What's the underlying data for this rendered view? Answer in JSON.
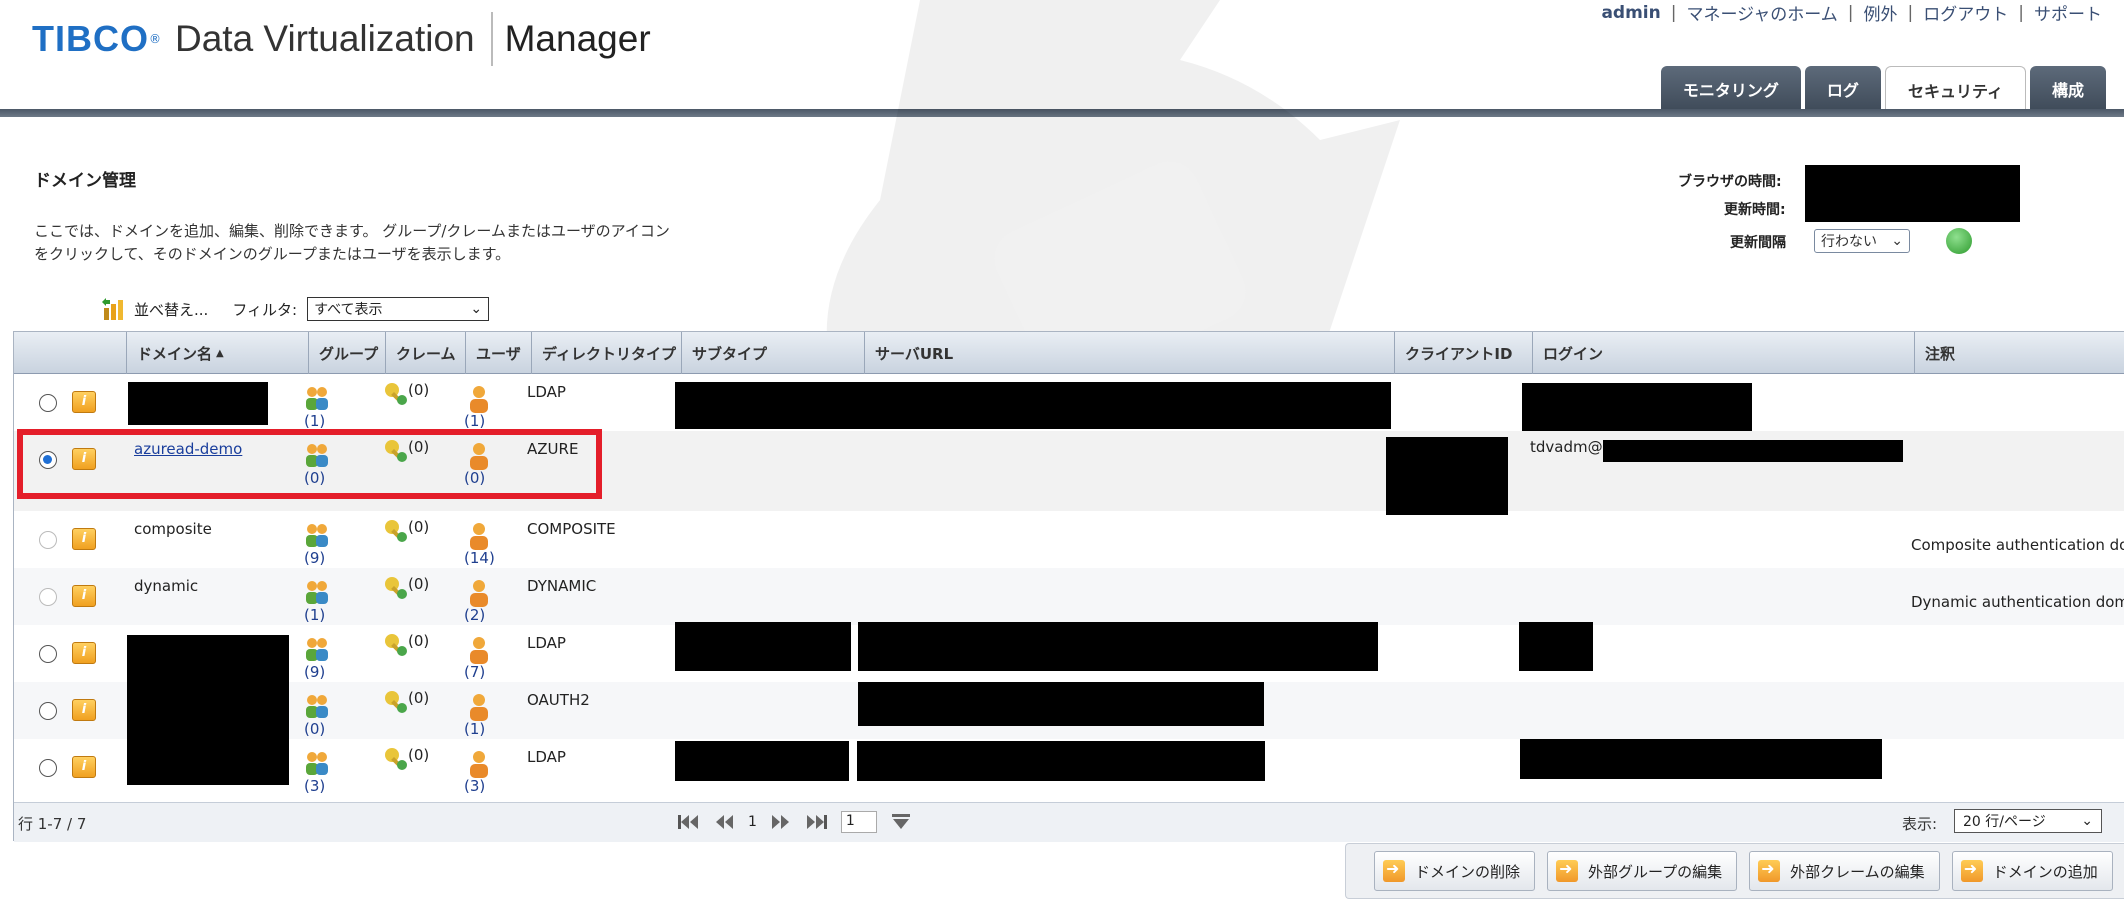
{
  "header": {
    "logo_brand": "TIBCO",
    "logo_reg": "®",
    "logo_product": "Data Virtualization",
    "logo_app": "Manager",
    "links": {
      "user": "admin",
      "home": "マネージャのホーム",
      "exceptions": "例外",
      "logout": "ログアウト",
      "support": "サポート"
    },
    "tabs": [
      {
        "label": "モニタリング",
        "active": false
      },
      {
        "label": "ログ",
        "active": false
      },
      {
        "label": "セキュリティ",
        "active": true
      },
      {
        "label": "構成",
        "active": false
      }
    ]
  },
  "page": {
    "title": "ドメイン管理",
    "description": "ここでは、ドメインを追加、編集、削除できます。 グループ/クレームまたはユーザのアイコンをクリックして、そのドメインのグループまたはユーザを表示します。"
  },
  "time_panel": {
    "browser_time_label": "ブラウザの時間:",
    "update_time_label": "更新時間:",
    "refresh_interval_label": "更新間隔",
    "refresh_interval_value": "行わない"
  },
  "toolbar": {
    "sort_label": "並べ替え...",
    "filter_label": "フィルタ:",
    "filter_value": "すべて表示"
  },
  "table": {
    "columns": {
      "domain_name": "ドメイン名",
      "group": "グループ",
      "claim": "クレーム",
      "user": "ユーザ",
      "directory_type": "ディレクトリタイプ",
      "subtype": "サブタイプ",
      "server_url": "サーバURL",
      "client_id": "クライアントID",
      "login": "ログイン",
      "notes": "注釈"
    },
    "rows": [
      {
        "name": "",
        "group_count": "(1)",
        "claim_count": "(0)",
        "user_count": "(1)",
        "dir_type": "LDAP",
        "login": "",
        "note": ""
      },
      {
        "name": "azuread-demo",
        "group_count": "(0)",
        "claim_count": "(0)",
        "user_count": "(0)",
        "dir_type": "AZURE",
        "login": "tdvadm@",
        "note": ""
      },
      {
        "name": "composite",
        "group_count": "(9)",
        "claim_count": "(0)",
        "user_count": "(14)",
        "dir_type": "COMPOSITE",
        "login": "",
        "note": "Composite authentication do"
      },
      {
        "name": "dynamic",
        "group_count": "(1)",
        "claim_count": "(0)",
        "user_count": "(2)",
        "dir_type": "DYNAMIC",
        "login": "",
        "note": "Dynamic authentication dom"
      },
      {
        "name": "",
        "group_count": "(9)",
        "claim_count": "(0)",
        "user_count": "(7)",
        "dir_type": "LDAP",
        "login": "",
        "note": ""
      },
      {
        "name": "",
        "group_count": "(0)",
        "claim_count": "(0)",
        "user_count": "(1)",
        "dir_type": "OAUTH2",
        "login": "",
        "note": ""
      },
      {
        "name": "",
        "group_count": "(3)",
        "claim_count": "(0)",
        "user_count": "(3)",
        "dir_type": "LDAP",
        "login": "",
        "note": ""
      }
    ],
    "footer": {
      "rows_label": "行 1-7 / 7",
      "current_page": "1",
      "page_input": "1",
      "per_page_label": "表示:",
      "per_page_value": "20 行/ページ"
    }
  },
  "actions": {
    "delete_domain": "ドメインの削除",
    "edit_ext_groups": "外部グループの編集",
    "edit_ext_claims": "外部クレームの編集",
    "add_domain": "ドメインの追加"
  },
  "colors": {
    "brand_blue": "#1f6fc4",
    "highlight_red": "#e41e2a",
    "link_blue": "#1a3e9c"
  }
}
